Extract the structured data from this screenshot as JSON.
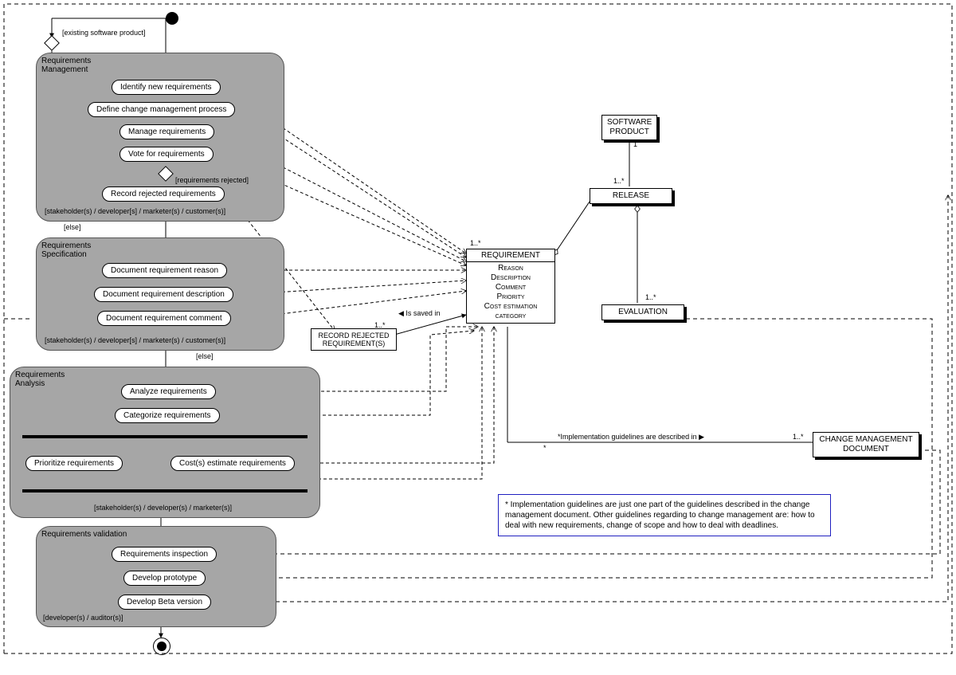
{
  "guards": {
    "existing": "[existing software product]",
    "reqRejected": "[requirements rejected]",
    "else1": "[else]",
    "else2": "[else]"
  },
  "phases": {
    "p1": {
      "title": "Requirements\nManagement",
      "roles": "[stakeholder(s) / developer[s] / marketer(s) / customer(s)]"
    },
    "p2": {
      "title": "Requirements\nSpecification",
      "roles": "[stakeholder(s) / developer[s] / marketer(s) / customer(s)]"
    },
    "p3": {
      "title": "Requirements\nAnalysis",
      "roles": "[stakeholder(s) / developer(s) / marketer(s)]"
    },
    "p4": {
      "title": "Requirements validation",
      "roles": "[developer(s) / auditor(s)]"
    }
  },
  "activities": {
    "a1": "Identify new requirements",
    "a2": "Define change management process",
    "a3": "Manage requirements",
    "a4": "Vote for requirements",
    "a5": "Record rejected requirements",
    "a6": "Document requirement reason",
    "a7": "Document requirement description",
    "a8": "Document requirement comment",
    "a9": "Analyze requirements",
    "a10": "Categorize requirements",
    "a11": "Prioritize requirements",
    "a12": "Cost(s) estimate requirements",
    "a13": "Requirements inspection",
    "a14": "Develop prototype",
    "a15": "Develop Beta version"
  },
  "classes": {
    "requirement": {
      "name": "REQUIREMENT",
      "attrs": [
        "Reason",
        "Description",
        "Comment",
        "Priority",
        "Cost estimation",
        "category"
      ]
    },
    "rejected": {
      "name": "RECORD REJECTED\nREQUIREMENT(S)"
    },
    "software": "SOFTWARE\nPRODUCT",
    "release": "RELEASE",
    "evaluation": "EVALUATION",
    "changeDoc": "CHANGE MANAGEMENT\nDOCUMENT"
  },
  "assoc": {
    "isSaved": "Is saved in",
    "implGuide": "*Implementation guidelines are described in",
    "m1": "1",
    "m1s": "1..*",
    "m1s2": "1..*",
    "m1s3": "1..*",
    "m1s4": "1..*",
    "m1s5": "1..*",
    "mstar": "*"
  },
  "noteText": "*   Implementation guidelines are just one part of the guidelines described in the change management document. Other guidelines regarding to change management are: how to deal with new requirements, change of scope and how to deal with deadlines."
}
